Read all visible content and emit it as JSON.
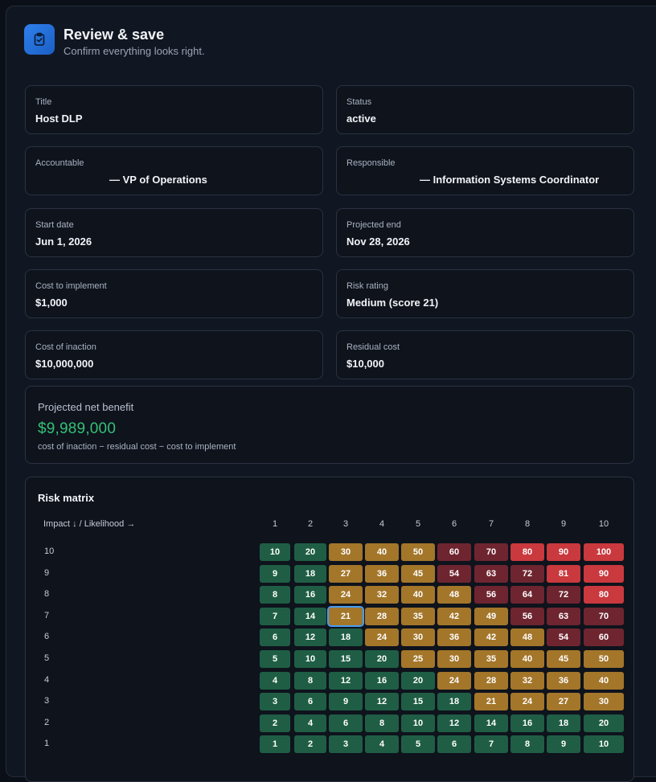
{
  "header": {
    "title": "Review & save",
    "subtitle": "Confirm everything looks right.",
    "icon": "clipboard-check-icon"
  },
  "fields": [
    {
      "label": "Title",
      "value": "Host DLP"
    },
    {
      "label": "Status",
      "value": "active"
    },
    {
      "label": "Accountable",
      "value": "— VP of Operations"
    },
    {
      "label": "Responsible",
      "value": "— Information Systems Coordinator"
    },
    {
      "label": "Start date",
      "value": "Jun 1, 2026"
    },
    {
      "label": "Projected end",
      "value": "Nov 28, 2026"
    },
    {
      "label": "Cost to implement",
      "value": "$1,000"
    },
    {
      "label": "Risk rating",
      "value": "Medium (score 21)"
    },
    {
      "label": "Cost of inaction",
      "value": "$10,000,000"
    },
    {
      "label": "Residual cost",
      "value": "$10,000"
    }
  ],
  "benefit": {
    "label": "Projected net benefit",
    "value": "$9,989,000",
    "formula": "cost of inaction − residual cost − cost to implement"
  },
  "matrix": {
    "title": "Risk matrix",
    "axis_label": "Impact ↓ / Likelihood →",
    "likelihood": [
      1,
      2,
      3,
      4,
      5,
      6,
      7,
      8,
      9,
      10
    ],
    "impact": [
      10,
      9,
      8,
      7,
      6,
      5,
      4,
      3,
      2,
      1
    ],
    "selected": {
      "impact": 7,
      "likelihood": 3
    },
    "colors": {
      "low": "#1f5e45",
      "medium": "#a3762a",
      "high": "#6e2530",
      "critical": "#c9393e",
      "selected_outline": "#4a9df0"
    }
  }
}
